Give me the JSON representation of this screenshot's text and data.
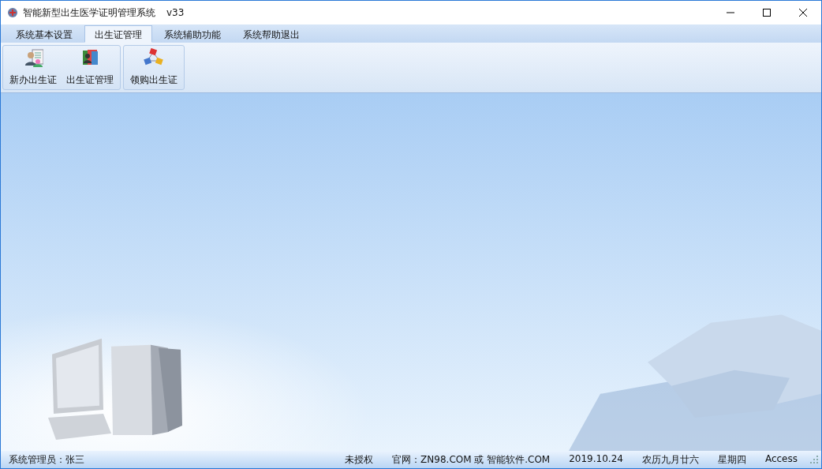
{
  "window": {
    "title": "智能新型出生医学证明管理系统",
    "version": "v33"
  },
  "tabs": [
    {
      "label": "系统基本设置",
      "selected": false
    },
    {
      "label": "出生证管理",
      "selected": true
    },
    {
      "label": "系统辅助功能",
      "selected": false
    },
    {
      "label": "系统帮助退出",
      "selected": false
    }
  ],
  "ribbon_groups": [
    {
      "buttons": [
        {
          "label": "新办出生证",
          "kind": "people"
        },
        {
          "label": "出生证管理",
          "kind": "book"
        }
      ]
    },
    {
      "buttons": [
        {
          "label": "领购出生证",
          "kind": "network"
        }
      ]
    }
  ],
  "status_bar": {
    "left": "系统管理员：张三",
    "items": [
      "未授权",
      "官网：ZN98.COM 或 智能软件.COM",
      "2019.10.24",
      "农历九月廿六",
      "星期四",
      "Access"
    ]
  }
}
